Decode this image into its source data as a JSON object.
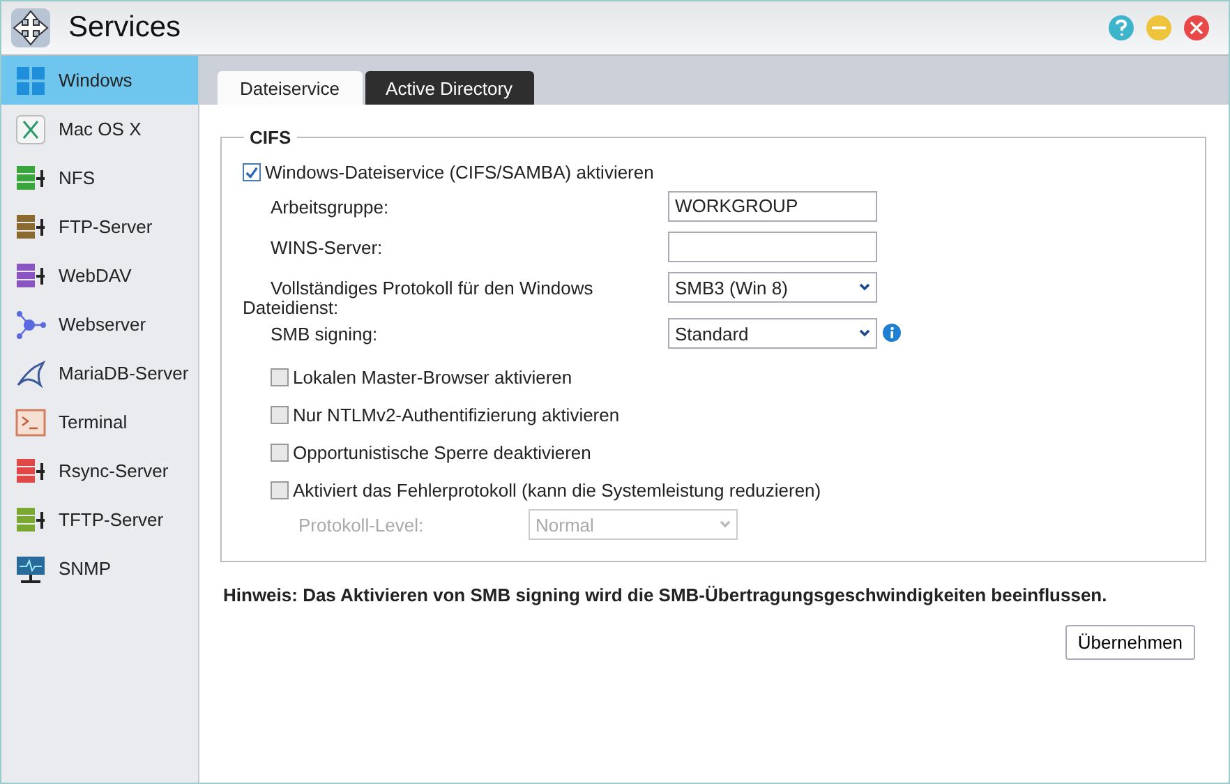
{
  "window": {
    "title": "Services"
  },
  "sidebar": {
    "items": [
      {
        "label": "Windows",
        "selected": true
      },
      {
        "label": "Mac OS X",
        "selected": false
      },
      {
        "label": "NFS",
        "selected": false
      },
      {
        "label": "FTP-Server",
        "selected": false
      },
      {
        "label": "WebDAV",
        "selected": false
      },
      {
        "label": "Webserver",
        "selected": false
      },
      {
        "label": "MariaDB-Server",
        "selected": false
      },
      {
        "label": "Terminal",
        "selected": false
      },
      {
        "label": "Rsync-Server",
        "selected": false
      },
      {
        "label": "TFTP-Server",
        "selected": false
      },
      {
        "label": "SNMP",
        "selected": false
      }
    ]
  },
  "tabs": [
    {
      "label": "Dateiservice",
      "selected": true
    },
    {
      "label": "Active Directory",
      "selected": false
    }
  ],
  "section": {
    "title": "CIFS",
    "enable": {
      "label": "Windows-Dateiservice (CIFS/SAMBA) aktivieren",
      "checked": true
    },
    "rows": [
      {
        "kind": "text",
        "label": "Arbeitsgruppe:",
        "value": "WORKGROUP",
        "disabled": false,
        "sub": false
      },
      {
        "kind": "text",
        "label": "WINS-Server:",
        "disabled": false,
        "sub": false
      },
      {
        "kind": "select",
        "label": "Vollständiges Protokoll für den Windows Dateidienst:",
        "value": "SMB3 (Win 8)",
        "disabled": false,
        "sub": false
      },
      {
        "kind": "select",
        "label": "SMB signing:",
        "value": "Standard",
        "disabled": false,
        "info": true,
        "sub": false
      },
      {
        "kind": "checkbox",
        "label": "Lokalen Master-Browser aktivieren",
        "checked": false
      },
      {
        "kind": "checkbox",
        "label": "Nur NTLMv2-Authentifizierung aktivieren",
        "checked": false
      },
      {
        "kind": "checkbox",
        "label": "Opportunistische Sperre deaktivieren",
        "checked": false
      },
      {
        "kind": "checkbox",
        "label": "Aktiviert das Fehlerprotokoll (kann die Systemleistung reduzieren)",
        "checked": false
      },
      {
        "kind": "select",
        "label": "Protokoll-Level:",
        "value": "Normal",
        "disabled": true,
        "sub": true
      }
    ]
  },
  "hint": "Hinweis: Das Aktivieren von SMB signing wird die SMB-Übertragungsgeschwindigkeiten beeinflussen.",
  "apply_button": "Übernehmen"
}
